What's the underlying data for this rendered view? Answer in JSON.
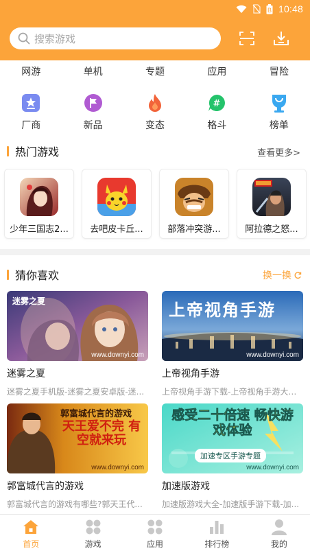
{
  "status": {
    "time": "10:48",
    "battery": "B"
  },
  "search": {
    "placeholder": "搜索游戏"
  },
  "categories": [
    "网游",
    "单机",
    "专题",
    "应用",
    "冒险"
  ],
  "icon_categories": [
    {
      "label": "厂商",
      "icon": "star-badge-icon",
      "color": "#7a8bf0"
    },
    {
      "label": "新品",
      "icon": "flag-icon",
      "color": "#b05bd2"
    },
    {
      "label": "变态",
      "icon": "flame-icon",
      "color": "#f2643a"
    },
    {
      "label": "格斗",
      "icon": "hashtag-chat-icon",
      "color": "#24c36b"
    },
    {
      "label": "榜单",
      "icon": "trophy-icon",
      "color": "#3aa8f0"
    }
  ],
  "hot": {
    "title": "热门游戏",
    "more": "查看更多>",
    "games": [
      {
        "name": "少年三国志2..."
      },
      {
        "name": "去吧皮卡丘..."
      },
      {
        "name": "部落冲突游..."
      },
      {
        "name": "阿拉德之怒..."
      }
    ]
  },
  "guess": {
    "title": "猜你喜欢",
    "refresh": "换一换",
    "items": [
      {
        "banner_text": "迷雾之夏",
        "watermark": "www.downyi.com",
        "title": "迷雾之夏",
        "desc": "迷雾之夏手机版-迷雾之夏安卓版-迷..."
      },
      {
        "banner_text": "上帝视角手游",
        "watermark": "www.downyi.com",
        "title": "上帝视角手游",
        "desc": "上帝视角手游下载-上帝视角手游大全..."
      },
      {
        "banner_text": "郭富城代言的游戏",
        "banner_sub": "天王爱不完 有空就来玩",
        "watermark": "www.downyi.com",
        "title": "郭富城代言的游戏",
        "desc": "郭富城代言的游戏有哪些?郭天王代..."
      },
      {
        "banner_text": "感受二十倍速 畅快游戏体验",
        "banner_sub": "加速专区手游专题",
        "watermark": "www.downyi.com",
        "title": "加速版游戏",
        "desc": "加速版游戏大全-加速版手游下载-加..."
      }
    ]
  },
  "nav": [
    {
      "label": "首页",
      "icon": "home-icon",
      "active": true
    },
    {
      "label": "游戏",
      "icon": "grid-dots-icon",
      "active": false
    },
    {
      "label": "应用",
      "icon": "apps-icon",
      "active": false
    },
    {
      "label": "排行榜",
      "icon": "bar-chart-icon",
      "active": false
    },
    {
      "label": "我的",
      "icon": "user-icon",
      "active": false
    }
  ],
  "colors": {
    "accent": "#fca43a",
    "header": "#fca43a",
    "muted": "#9a9a9a"
  }
}
